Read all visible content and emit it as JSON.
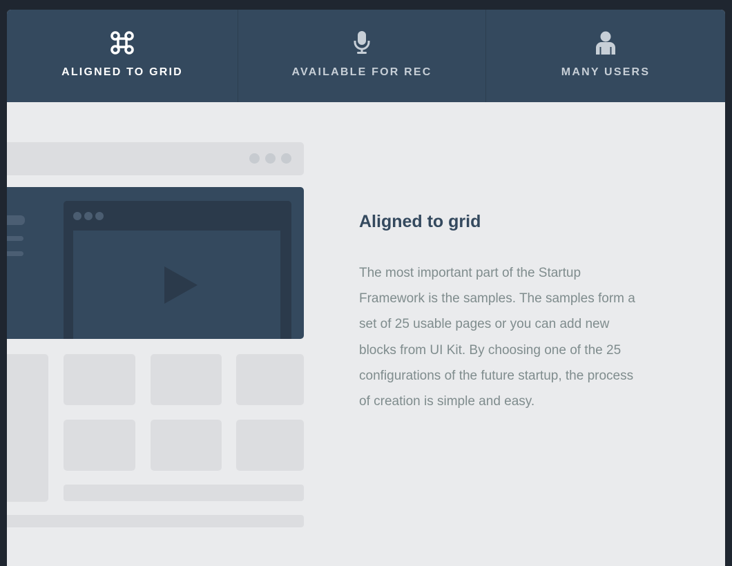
{
  "tabs": [
    {
      "label": "ALIGNED TO GRID",
      "icon": "command-icon",
      "active": true
    },
    {
      "label": "AVAILABLE FOR REC",
      "icon": "microphone-icon",
      "active": false
    },
    {
      "label": "MANY USERS",
      "icon": "user-icon",
      "active": false
    }
  ],
  "feature": {
    "title": "Aligned to grid",
    "description": "The most important part of the Startup Framework is the samples. The samples form a set of 25 usable pages or you can add new blocks from UI Kit. By choosing one of the 25 configurations of the future startup, the process of creation is simple and easy."
  },
  "colors": {
    "tabbar": "#34495e",
    "page_bg": "#eaebed",
    "title": "#34495e",
    "body_text": "#7f8c8d"
  }
}
